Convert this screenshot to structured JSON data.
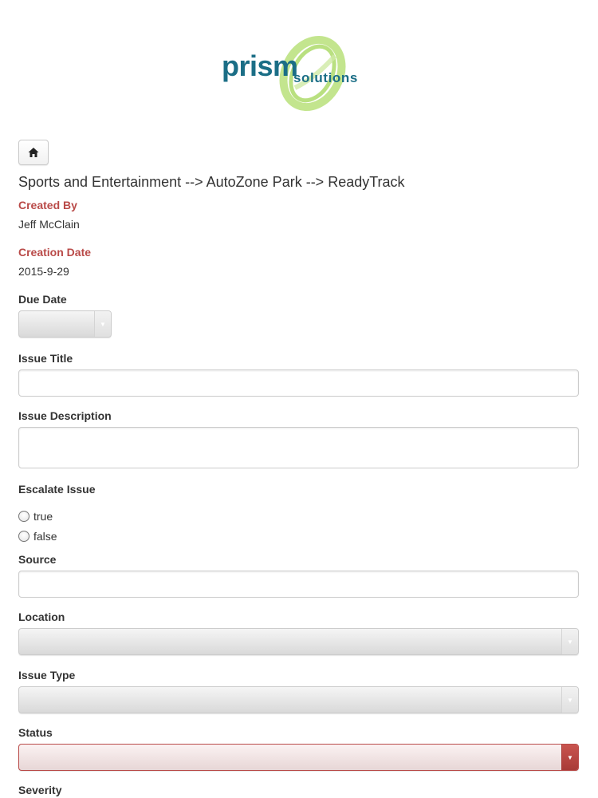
{
  "logo": {
    "word_main": "prism",
    "word_sub": "solutions",
    "brand_color": "#1b6e86",
    "swirl_color": "#9bd34a"
  },
  "nav": {
    "home_icon": "home-icon"
  },
  "breadcrumb": "Sports and Entertainment --> AutoZone Park --> ReadyTrack",
  "created_by": {
    "label": "Created By",
    "value": "Jeff McClain"
  },
  "creation_date": {
    "label": "Creation Date",
    "value": "2015-9-29"
  },
  "form": {
    "due_date": {
      "label": "Due Date",
      "value": ""
    },
    "issue_title": {
      "label": "Issue Title",
      "value": ""
    },
    "issue_description": {
      "label": "Issue Description",
      "value": ""
    },
    "escalate_issue": {
      "label": "Escalate Issue",
      "options": [
        "true",
        "false"
      ],
      "selected": ""
    },
    "source": {
      "label": "Source",
      "value": ""
    },
    "location": {
      "label": "Location",
      "value": ""
    },
    "issue_type": {
      "label": "Issue Type",
      "value": ""
    },
    "status": {
      "label": "Status",
      "value": "",
      "state_color": "#b94a48"
    },
    "severity": {
      "label": "Severity"
    }
  },
  "colors": {
    "required_label": "#b94a48"
  }
}
